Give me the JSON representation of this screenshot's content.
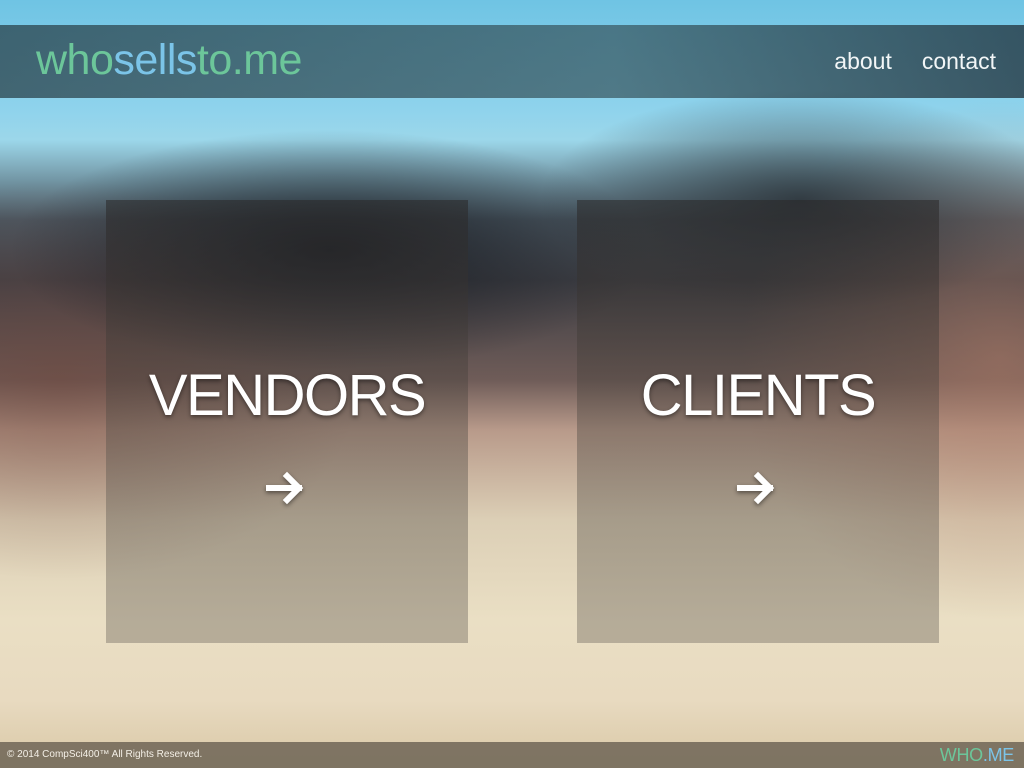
{
  "header": {
    "logo_part1": "who",
    "logo_part2": "sells",
    "logo_part3": "to.me",
    "nav": [
      {
        "label": "about"
      },
      {
        "label": "contact"
      }
    ]
  },
  "cards": [
    {
      "title": "VENDORS",
      "icon": "arrow-right-icon"
    },
    {
      "title": "CLIENTS",
      "icon": "arrow-right-icon"
    }
  ],
  "footer": {
    "copyright": "© 2014 CompSci400™ All Rights Reserved.",
    "brand_part1": "WHO",
    "brand_part2": ".ME"
  },
  "colors": {
    "logo_green": "#6cc69a",
    "logo_blue": "#7bc4e8"
  }
}
